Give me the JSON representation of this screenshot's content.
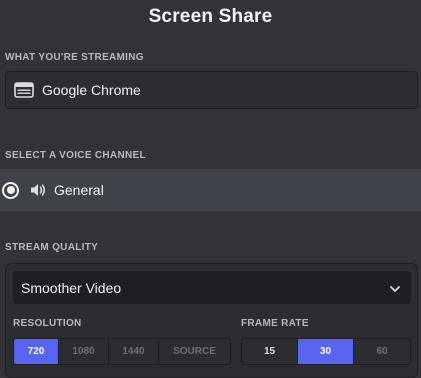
{
  "title": "Screen Share",
  "streaming": {
    "label": "WHAT YOU'RE STREAMING",
    "source": "Google Chrome",
    "icon": "browser-window-icon"
  },
  "channel": {
    "label": "SELECT A VOICE CHANNEL",
    "name": "General",
    "selected": true,
    "icon": "speaker-icon"
  },
  "quality": {
    "label": "STREAM QUALITY",
    "preset": "Smoother Video",
    "resolution_label": "RESOLUTION",
    "resolution_options": [
      "720",
      "1080",
      "1440",
      "SOURCE"
    ],
    "resolution_selected": "720",
    "framerate_label": "FRAME RATE",
    "framerate_options": [
      "15",
      "30",
      "60"
    ],
    "framerate_selected": "30"
  },
  "colors": {
    "background": "#313338",
    "accent": "#5865f2",
    "panel": "#2b2d31",
    "selected_row": "#404249"
  }
}
